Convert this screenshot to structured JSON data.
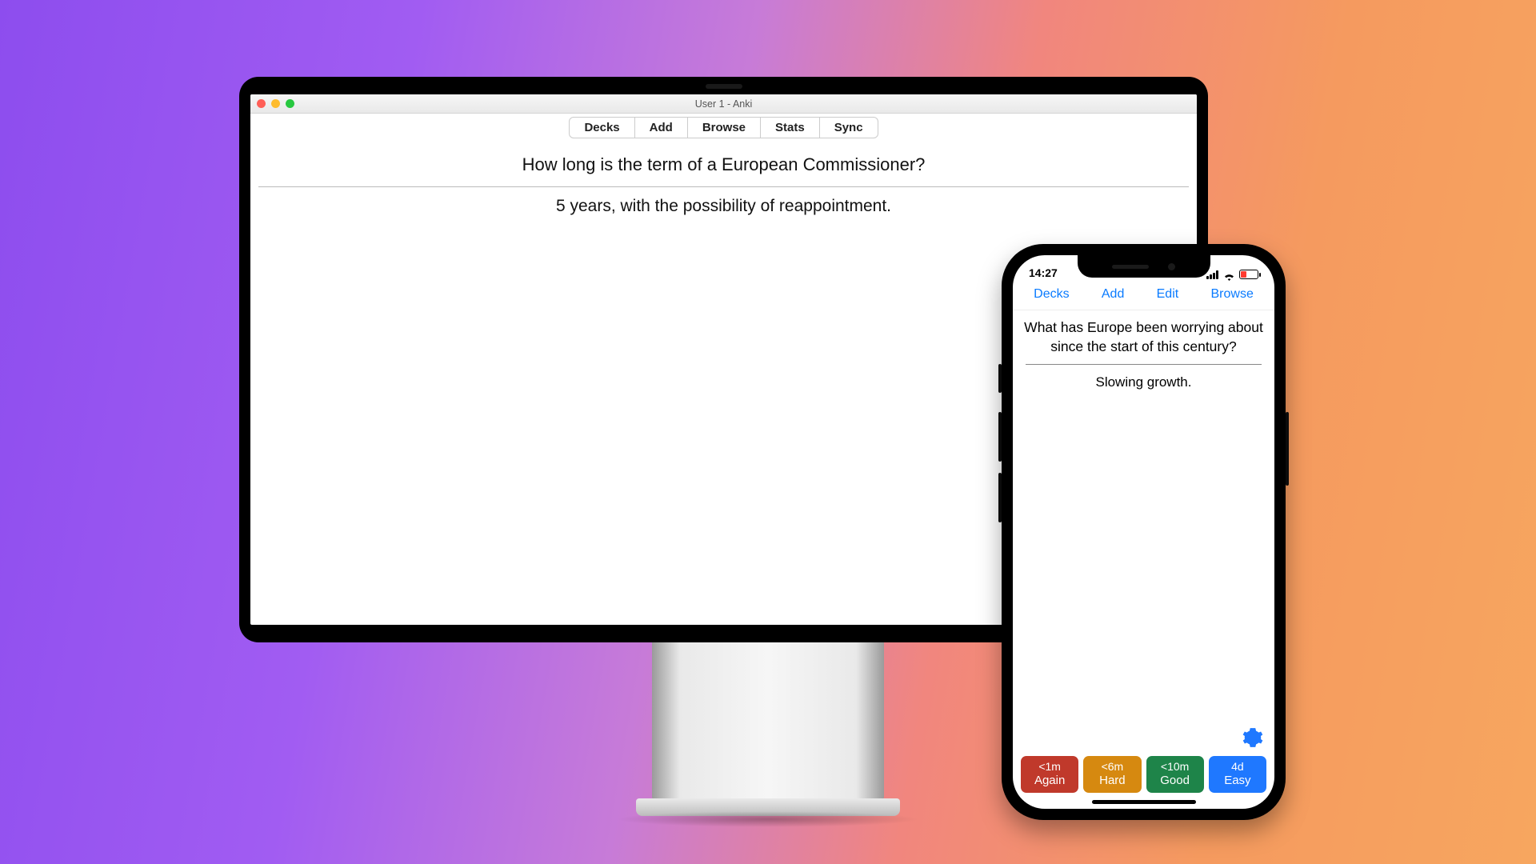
{
  "desktop": {
    "window_title": "User 1 - Anki",
    "toolbar": {
      "decks": "Decks",
      "add": "Add",
      "browse": "Browse",
      "stats": "Stats",
      "sync": "Sync"
    },
    "card": {
      "question": "How long is the term of a European Commissioner?",
      "answer": "5 years, with the possibility of reappointment."
    }
  },
  "phone": {
    "status": {
      "time": "14:27"
    },
    "toolbar": {
      "decks": "Decks",
      "add": "Add",
      "edit": "Edit",
      "browse": "Browse"
    },
    "card": {
      "question": "What has Europe been worrying about since the start of this century?",
      "answer": "Slowing growth."
    },
    "answers": {
      "again": {
        "time": "<1m",
        "label": "Again"
      },
      "hard": {
        "time": "<6m",
        "label": "Hard"
      },
      "good": {
        "time": "<10m",
        "label": "Good"
      },
      "easy": {
        "time": "4d",
        "label": "Easy"
      }
    },
    "icons": {
      "gear": "gear-icon"
    },
    "colors": {
      "accent": "#0a7bff",
      "again": "#c0392b",
      "hard": "#d68910",
      "good": "#1e8449",
      "easy": "#1f78ff"
    }
  }
}
